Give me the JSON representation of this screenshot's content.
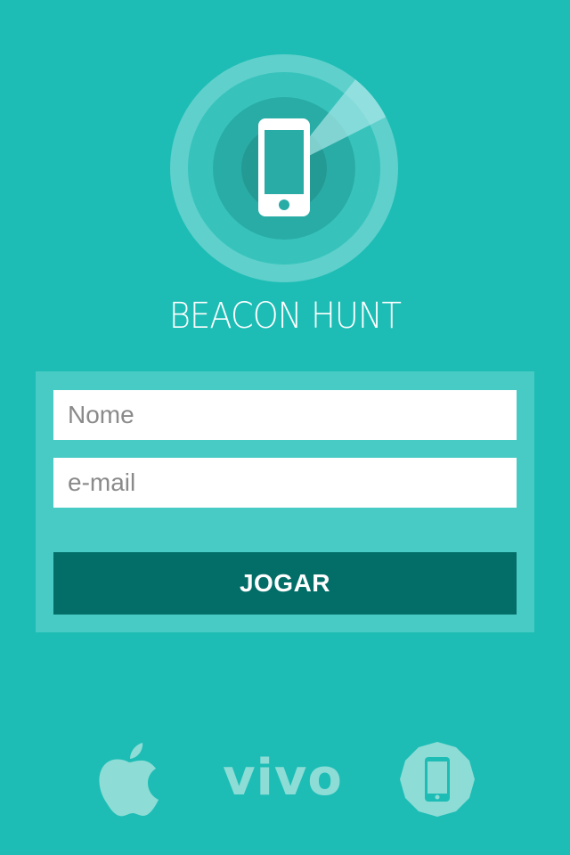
{
  "app": {
    "title": "BEACON HUNT"
  },
  "form": {
    "name_placeholder": "Nome",
    "email_placeholder": "e-mail",
    "name_value": "",
    "email_value": "",
    "submit_label": "JOGAR"
  },
  "sponsors": {
    "apple_icon": "apple-logo",
    "vivo_label": "vivo",
    "phone_badge_icon": "smartphone-badge"
  },
  "colors": {
    "background": "#1dbdb5",
    "panel": "#48cbc5",
    "button": "#036d68",
    "sponsor_tint": "#8ddcd6"
  }
}
